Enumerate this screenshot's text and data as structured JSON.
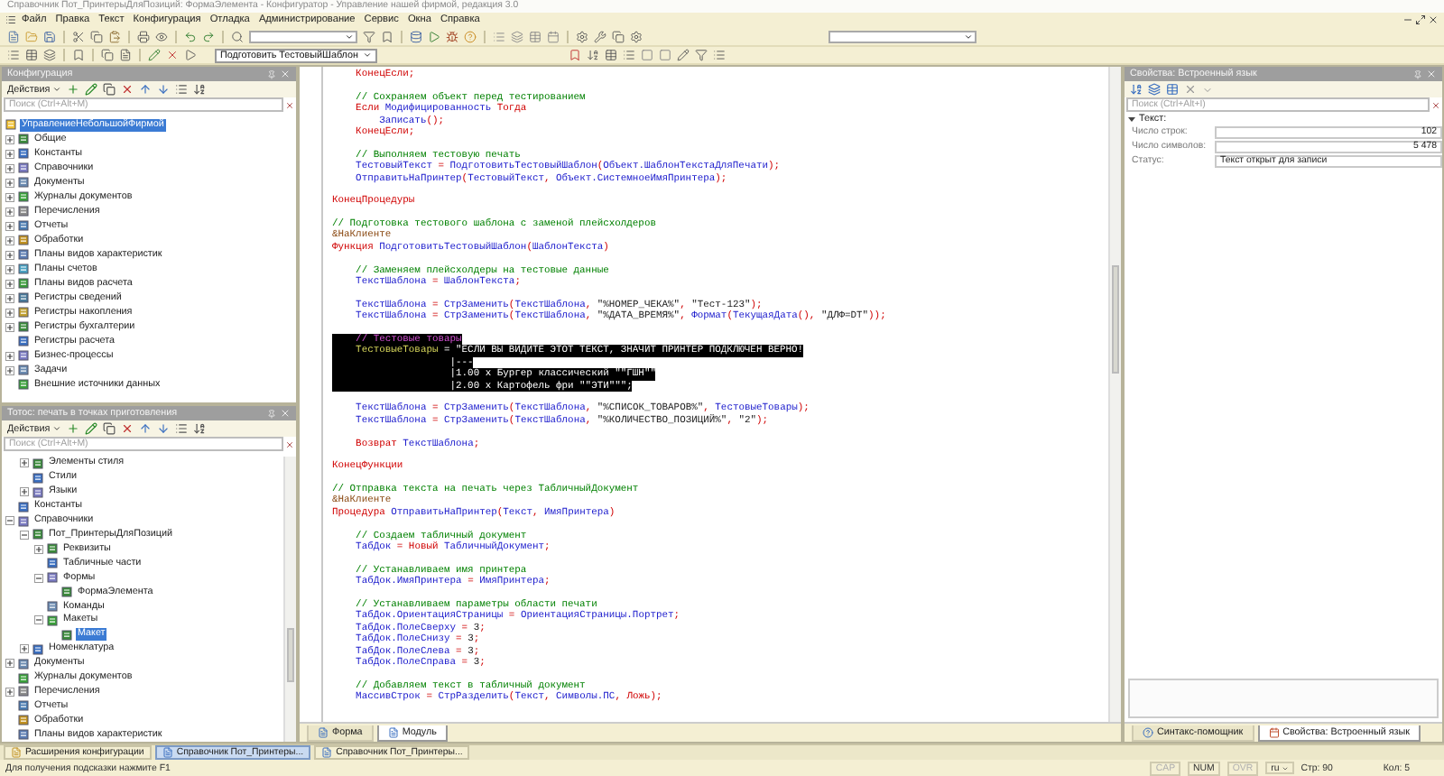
{
  "window": {
    "title": "Справочник Пот_ПринтерыДляПозиций: ФормаЭлемента - Конфигуратор - Управление нашей фирмой, редакция 3.0"
  },
  "menu": [
    "Файл",
    "Правка",
    "Текст",
    "Конфигурация",
    "Отладка",
    "Администрирование",
    "Сервис",
    "Окна",
    "Справка"
  ],
  "toolbar": {
    "procedure": "Подготовить ТестовыйШаблон"
  },
  "config_panel": {
    "title": "Конфигурация",
    "actions": "Действия",
    "search": {
      "placeholder": "Поиск (Ctrl+Alt+M)"
    },
    "tree": [
      {
        "label": "УправлениеНебольшойФирмой",
        "kind": "root",
        "selected": true,
        "children": [
          {
            "label": "Общие",
            "kind": "folder",
            "expanded": false,
            "selected": false
          },
          {
            "label": "Константы",
            "kind": "folder",
            "expanded": false,
            "selected": false
          },
          {
            "label": "Справочники",
            "kind": "folder",
            "expanded": false,
            "selected": false
          },
          {
            "label": "Документы",
            "kind": "folder",
            "expanded": false,
            "selected": false
          },
          {
            "label": "Журналы документов",
            "kind": "folder",
            "expanded": false,
            "selected": false
          },
          {
            "label": "Перечисления",
            "kind": "folder",
            "expanded": false,
            "selected": false
          },
          {
            "label": "Отчеты",
            "kind": "folder",
            "expanded": false,
            "selected": false
          },
          {
            "label": "Обработки",
            "kind": "folder",
            "expanded": false,
            "selected": false
          },
          {
            "label": "Планы видов характеристик",
            "kind": "folder",
            "expanded": false,
            "selected": false
          },
          {
            "label": "Планы счетов",
            "kind": "folder",
            "expanded": false,
            "selected": false
          },
          {
            "label": "Планы видов расчета",
            "kind": "folder",
            "expanded": false,
            "selected": false
          },
          {
            "label": "Регистры сведений",
            "kind": "folder",
            "expanded": false,
            "selected": false
          },
          {
            "label": "Регистры накопления",
            "kind": "folder",
            "expanded": false,
            "selected": false
          },
          {
            "label": "Регистры бухгалтерии",
            "kind": "folder",
            "expanded": false,
            "selected": false
          },
          {
            "label": "Регистры расчета",
            "kind": "leaf",
            "selected": false
          },
          {
            "label": "Бизнес-процессы",
            "kind": "folder",
            "expanded": false,
            "selected": false
          },
          {
            "label": "Задачи",
            "kind": "folder",
            "expanded": false,
            "selected": false
          },
          {
            "label": "Внешние источники данных",
            "kind": "leaf",
            "selected": false
          }
        ]
      }
    ]
  },
  "objects_panel": {
    "title": "Тотос: печать в точках приготовления",
    "actions": "Действия",
    "search": {
      "placeholder": "Поиск (Ctrl+Alt+M)"
    },
    "tree": [
      {
        "children": [
          {
            "label": "Элементы стиля",
            "kind": "folder",
            "expanded": false,
            "selected": false
          },
          {
            "label": "Стили",
            "kind": "leaf",
            "selected": false
          },
          {
            "label": "Языки",
            "kind": "folder",
            "expanded": false,
            "selected": false
          }
        ]
      },
      {
        "label": "Константы",
        "kind": "leaf",
        "selected": false
      },
      {
        "label": "Справочники",
        "kind": "folder",
        "expanded": true,
        "selected": false,
        "children": [
          {
            "label": "Пот_ПринтерыДляПозиций",
            "kind": "folder",
            "expanded": true,
            "selected": false,
            "children": [
              {
                "label": "Реквизиты",
                "kind": "folder",
                "expanded": false,
                "selected": false
              },
              {
                "label": "Табличные части",
                "kind": "leaf",
                "selected": false
              },
              {
                "label": "Формы",
                "kind": "folder",
                "expanded": true,
                "selected": false,
                "children": [
                  {
                    "label": "ФормаЭлемента",
                    "kind": "leaf",
                    "selected": false
                  }
                ]
              },
              {
                "label": "Команды",
                "kind": "leaf",
                "selected": false
              },
              {
                "label": "Макеты",
                "kind": "folder",
                "expanded": true,
                "selected": false,
                "children": [
                  {
                    "label": "Макет",
                    "kind": "leaf",
                    "selected": true
                  }
                ]
              }
            ]
          },
          {
            "label": "Номенклатура",
            "kind": "folder",
            "expanded": false,
            "selected": false
          }
        ]
      },
      {
        "label": "Документы",
        "kind": "folder",
        "expanded": false,
        "selected": false
      },
      {
        "label": "Журналы документов",
        "kind": "leaf",
        "selected": false
      },
      {
        "label": "Перечисления",
        "kind": "folder",
        "expanded": false,
        "selected": false
      },
      {
        "label": "Отчеты",
        "kind": "leaf",
        "selected": false
      },
      {
        "label": "Обработки",
        "kind": "leaf",
        "selected": false
      },
      {
        "label": "Планы видов характеристик",
        "kind": "leaf",
        "selected": false
      }
    ]
  },
  "editor": {
    "blocks": [
      {
        "highlighted": false,
        "lines": [
          [
            {
              "kind": "keyword",
              "text": "    КонецЕсли;"
            }
          ]
        ]
      },
      {
        "highlighted": false,
        "lines": [
          [
            {
              "kind": "comment",
              "text": "    // Сохраняем объект перед тестированием"
            }
          ],
          [
            {
              "kind": "keyword",
              "text": "    Если "
            },
            {
              "kind": "name",
              "text": "Модифицированность "
            },
            {
              "kind": "keyword",
              "text": "Тогда"
            }
          ],
          [
            {
              "kind": "name",
              "text": "        Записать"
            },
            {
              "kind": "keyword",
              "text": "();"
            }
          ],
          [
            {
              "kind": "keyword",
              "text": "    КонецЕсли;"
            }
          ]
        ]
      },
      {
        "highlighted": false,
        "lines": [
          [
            {
              "kind": "comment",
              "text": "    // Выполняем тестовую печать"
            }
          ],
          [
            {
              "kind": "name",
              "text": "    ТестовыйТекст "
            },
            {
              "kind": "keyword",
              "text": "= "
            },
            {
              "kind": "name",
              "text": "ПодготовитьТестовыйШаблон"
            },
            {
              "kind": "keyword",
              "text": "("
            },
            {
              "kind": "name",
              "text": "Объект.ШаблонТекстаДляПечати"
            },
            {
              "kind": "keyword",
              "text": ");"
            }
          ],
          [
            {
              "kind": "name",
              "text": "    ОтправитьНаПринтер"
            },
            {
              "kind": "keyword",
              "text": "("
            },
            {
              "kind": "name",
              "text": "ТестовыйТекст"
            },
            {
              "kind": "keyword",
              "text": ", "
            },
            {
              "kind": "name",
              "text": "Объект.СистемноеИмяПринтера"
            },
            {
              "kind": "keyword",
              "text": ");"
            }
          ]
        ]
      },
      {
        "highlighted": false,
        "lines": [
          [
            {
              "kind": "keyword",
              "text": "КонецПроцедуры"
            }
          ]
        ]
      },
      {
        "highlighted": false,
        "lines": [
          [
            {
              "kind": "comment",
              "text": "// Подготовка тестового шаблона с заменой плейсхолдеров"
            }
          ],
          [
            {
              "kind": "directive",
              "text": "&НаКлиенте"
            }
          ],
          [
            {
              "kind": "keyword",
              "text": "Функция "
            },
            {
              "kind": "name",
              "text": "ПодготовитьТестовыйШаблон"
            },
            {
              "kind": "keyword",
              "text": "("
            },
            {
              "kind": "name",
              "text": "ШаблонТекста"
            },
            {
              "kind": "keyword",
              "text": ")"
            }
          ]
        ]
      },
      {
        "highlighted": false,
        "lines": [
          [
            {
              "kind": "comment",
              "text": "    // Заменяем плейсхолдеры на тестовые данные"
            }
          ],
          [
            {
              "kind": "name",
              "text": "    ТекстШаблона "
            },
            {
              "kind": "keyword",
              "text": "= "
            },
            {
              "kind": "name",
              "text": "ШаблонТекста"
            },
            {
              "kind": "keyword",
              "text": ";"
            }
          ]
        ]
      },
      {
        "highlighted": false,
        "lines": [
          [
            {
              "kind": "name",
              "text": "    ТекстШаблона "
            },
            {
              "kind": "keyword",
              "text": "= "
            },
            {
              "kind": "name",
              "text": "СтрЗаменить"
            },
            {
              "kind": "keyword",
              "text": "("
            },
            {
              "kind": "name",
              "text": "ТекстШаблона"
            },
            {
              "kind": "keyword",
              "text": ", "
            },
            {
              "kind": "string",
              "text": "\"%НОМЕР_ЧЕКА%\""
            },
            {
              "kind": "keyword",
              "text": ", "
            },
            {
              "kind": "string",
              "text": "\"Тест-123\""
            },
            {
              "kind": "keyword",
              "text": ");"
            }
          ],
          [
            {
              "kind": "name",
              "text": "    ТекстШаблона "
            },
            {
              "kind": "keyword",
              "text": "= "
            },
            {
              "kind": "name",
              "text": "СтрЗаменить"
            },
            {
              "kind": "keyword",
              "text": "("
            },
            {
              "kind": "name",
              "text": "ТекстШаблона"
            },
            {
              "kind": "keyword",
              "text": ", "
            },
            {
              "kind": "string",
              "text": "\"%ДАТА_ВРЕМЯ%\""
            },
            {
              "kind": "keyword",
              "text": ", "
            },
            {
              "kind": "name",
              "text": "Формат"
            },
            {
              "kind": "keyword",
              "text": "("
            },
            {
              "kind": "name",
              "text": "ТекущаяДата"
            },
            {
              "kind": "keyword",
              "text": "(), "
            },
            {
              "kind": "string",
              "text": "\"ДЛФ=DT\""
            },
            {
              "kind": "keyword",
              "text": "));"
            }
          ]
        ]
      },
      {
        "highlighted": true,
        "lines": [
          [
            {
              "kind": "comment",
              "text": "    // Тестовые товары"
            }
          ],
          [
            {
              "kind": "name",
              "text": "    ТестовыеТовары "
            },
            {
              "kind": "keyword",
              "text": "= "
            },
            {
              "kind": "string",
              "text": "\"ЕСЛИ ВЫ ВИДИТЕ ЭТОТ ТЕКСТ, ЗНАЧИТ ПРИНТЕР ПОДКЛЮЧЕН ВЕРНО!"
            }
          ],
          [
            {
              "kind": "string",
              "text": "                    |---"
            }
          ],
          [
            {
              "kind": "string",
              "text": "                    |1.00 x Бургер классический \"\"ГШН\"\""
            }
          ],
          [
            {
              "kind": "string",
              "text": "                    |2.00 x Картофель фри \"\"ЭТИ\"\"\""
            },
            {
              "kind": "keyword",
              "text": ";"
            }
          ]
        ]
      },
      {
        "highlighted": false,
        "lines": [
          [
            {
              "kind": "name",
              "text": "    ТекстШаблона "
            },
            {
              "kind": "keyword",
              "text": "= "
            },
            {
              "kind": "name",
              "text": "СтрЗаменить"
            },
            {
              "kind": "keyword",
              "text": "("
            },
            {
              "kind": "name",
              "text": "ТекстШаблона"
            },
            {
              "kind": "keyword",
              "text": ", "
            },
            {
              "kind": "string",
              "text": "\"%СПИСОК_ТОВАРОВ%\""
            },
            {
              "kind": "keyword",
              "text": ", "
            },
            {
              "kind": "name",
              "text": "ТестовыеТовары"
            },
            {
              "kind": "keyword",
              "text": ");"
            }
          ],
          [
            {
              "kind": "name",
              "text": "    ТекстШаблона "
            },
            {
              "kind": "keyword",
              "text": "= "
            },
            {
              "kind": "name",
              "text": "СтрЗаменить"
            },
            {
              "kind": "keyword",
              "text": "("
            },
            {
              "kind": "name",
              "text": "ТекстШаблона"
            },
            {
              "kind": "keyword",
              "text": ", "
            },
            {
              "kind": "string",
              "text": "\"%КОЛИЧЕСТВО_ПОЗИЦИЙ%\""
            },
            {
              "kind": "keyword",
              "text": ", "
            },
            {
              "kind": "string",
              "text": "\"2\""
            },
            {
              "kind": "keyword",
              "text": ");"
            }
          ]
        ]
      },
      {
        "highlighted": false,
        "lines": [
          [
            {
              "kind": "keyword",
              "text": "    Возврат "
            },
            {
              "kind": "name",
              "text": "ТекстШаблона"
            },
            {
              "kind": "keyword",
              "text": ";"
            }
          ]
        ]
      },
      {
        "highlighted": false,
        "lines": [
          [
            {
              "kind": "keyword",
              "text": "КонецФункции"
            }
          ]
        ]
      },
      {
        "highlighted": false,
        "lines": [
          [
            {
              "kind": "comment",
              "text": "// Отправка текста на печать через ТабличныйДокумент"
            }
          ],
          [
            {
              "kind": "directive",
              "text": "&НаКлиенте"
            }
          ],
          [
            {
              "kind": "keyword",
              "text": "Процедура "
            },
            {
              "kind": "name",
              "text": "ОтправитьНаПринтер"
            },
            {
              "kind": "keyword",
              "text": "("
            },
            {
              "kind": "name",
              "text": "Текст"
            },
            {
              "kind": "keyword",
              "text": ", "
            },
            {
              "kind": "name",
              "text": "ИмяПринтера"
            },
            {
              "kind": "keyword",
              "text": ")"
            }
          ]
        ]
      },
      {
        "highlighted": false,
        "lines": [
          [
            {
              "kind": "comment",
              "text": "    // Создаем табличный документ"
            }
          ],
          [
            {
              "kind": "name",
              "text": "    ТабДок "
            },
            {
              "kind": "keyword",
              "text": "= Новый "
            },
            {
              "kind": "name",
              "text": "ТабличныйДокумент"
            },
            {
              "kind": "keyword",
              "text": ";"
            }
          ]
        ]
      },
      {
        "highlighted": false,
        "lines": [
          [
            {
              "kind": "comment",
              "text": "    // Устанавливаем имя принтера"
            }
          ],
          [
            {
              "kind": "name",
              "text": "    ТабДок.ИмяПринтера "
            },
            {
              "kind": "keyword",
              "text": "= "
            },
            {
              "kind": "name",
              "text": "ИмяПринтера"
            },
            {
              "kind": "keyword",
              "text": ";"
            }
          ]
        ]
      },
      {
        "highlighted": false,
        "lines": [
          [
            {
              "kind": "comment",
              "text": "    // Устанавливаем параметры области печати"
            }
          ],
          [
            {
              "kind": "name",
              "text": "    ТабДок.ОриентацияСтраницы "
            },
            {
              "kind": "keyword",
              "text": "= "
            },
            {
              "kind": "name",
              "text": "ОриентацияСтраницы.Портрет"
            },
            {
              "kind": "keyword",
              "text": ";"
            }
          ],
          [
            {
              "kind": "name",
              "text": "    ТабДок.ПолеСверху "
            },
            {
              "kind": "keyword",
              "text": "= "
            },
            {
              "kind": "string",
              "text": "3"
            },
            {
              "kind": "keyword",
              "text": ";"
            }
          ],
          [
            {
              "kind": "name",
              "text": "    ТабДок.ПолеСнизу "
            },
            {
              "kind": "keyword",
              "text": "= "
            },
            {
              "kind": "string",
              "text": "3"
            },
            {
              "kind": "keyword",
              "text": ";"
            }
          ],
          [
            {
              "kind": "name",
              "text": "    ТабДок.ПолеСлева "
            },
            {
              "kind": "keyword",
              "text": "= "
            },
            {
              "kind": "string",
              "text": "3"
            },
            {
              "kind": "keyword",
              "text": ";"
            }
          ],
          [
            {
              "kind": "name",
              "text": "    ТабДок.ПолеСправа "
            },
            {
              "kind": "keyword",
              "text": "= "
            },
            {
              "kind": "string",
              "text": "3"
            },
            {
              "kind": "keyword",
              "text": ";"
            }
          ]
        ]
      },
      {
        "highlighted": false,
        "lines": [
          [
            {
              "kind": "comment",
              "text": "    // Добавляем текст в табличный документ"
            }
          ],
          [
            {
              "kind": "name",
              "text": "    МассивСтрок "
            },
            {
              "kind": "keyword",
              "text": "= "
            },
            {
              "kind": "name",
              "text": "СтрРазделить"
            },
            {
              "kind": "keyword",
              "text": "("
            },
            {
              "kind": "name",
              "text": "Текст"
            },
            {
              "kind": "keyword",
              "text": ", "
            },
            {
              "kind": "name",
              "text": "Символы.ПС"
            },
            {
              "kind": "keyword",
              "text": ", Ложь);"
            }
          ]
        ]
      }
    ],
    "tabs": [
      {
        "label": "Форма",
        "selected": false
      },
      {
        "label": "Модуль",
        "selected": true
      }
    ]
  },
  "properties_panel": {
    "title": "Свойства: Встроенный язык",
    "search": {
      "placeholder": "Поиск (Ctrl+Alt+I)"
    },
    "group": {
      "label": "Текст:",
      "expanded": true,
      "rows": [
        {
          "label": "Число строк:",
          "value": "102",
          "kind": "number"
        },
        {
          "label": "Число символов:",
          "value": "5 478",
          "kind": "number"
        },
        {
          "label": "Статус:",
          "value": "Текст открыт для записи",
          "kind": "text"
        }
      ]
    },
    "tabs": [
      {
        "label": "Синтакс-помощник",
        "selected": false
      },
      {
        "label": "Свойства: Встроенный язык",
        "selected": true
      }
    ]
  },
  "taskbar": [
    {
      "label": "Расширения конфигурации",
      "selected": false
    },
    {
      "label": "Справочник Пот_Принтеры...",
      "selected": true
    },
    {
      "label": "Справочник Пот_Принтеры...",
      "selected": false
    }
  ],
  "status_bar": {
    "hint": "Для получения подсказки нажмите F1",
    "indicators": [
      {
        "label": "CAP",
        "on": false
      },
      {
        "label": "NUM",
        "on": true
      },
      {
        "label": "OVR",
        "on": false
      }
    ],
    "language": "ru",
    "line": "Стр: 90",
    "column": "Кол: 5"
  }
}
